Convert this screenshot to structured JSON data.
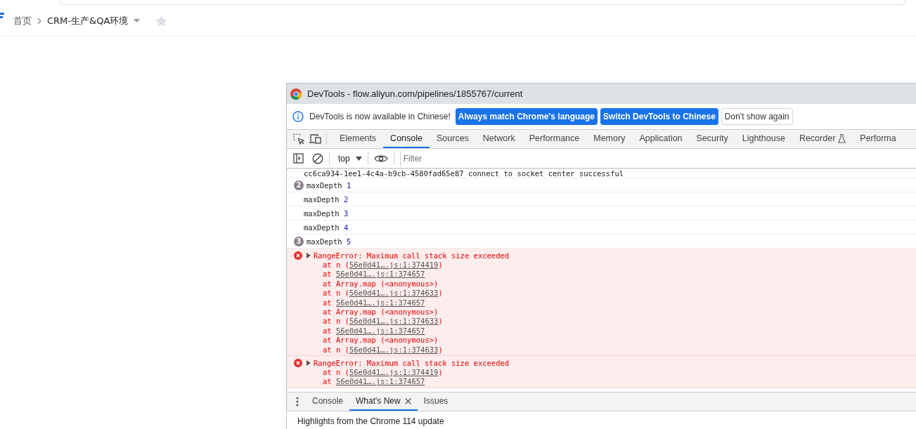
{
  "breadcrumb": {
    "home": "首页",
    "current": "CRM-生产&QA环境",
    "starred": false
  },
  "devtools": {
    "title": "DevTools - flow.aliyun.com/pipelines/1855767/current",
    "infobar": {
      "message": "DevTools is now available in Chinese!",
      "buttons": [
        {
          "label": "Always match Chrome's language",
          "kind": "primary"
        },
        {
          "label": "Switch DevTools to Chinese",
          "kind": "primary"
        },
        {
          "label": "Don't show again",
          "kind": "secondary"
        }
      ]
    },
    "tabs": [
      {
        "label": "Elements",
        "selected": false,
        "experimental": false
      },
      {
        "label": "Console",
        "selected": true,
        "experimental": false
      },
      {
        "label": "Sources",
        "selected": false,
        "experimental": false
      },
      {
        "label": "Network",
        "selected": false,
        "experimental": false
      },
      {
        "label": "Performance",
        "selected": false,
        "experimental": false
      },
      {
        "label": "Memory",
        "selected": false,
        "experimental": false
      },
      {
        "label": "Application",
        "selected": false,
        "experimental": false
      },
      {
        "label": "Security",
        "selected": false,
        "experimental": false
      },
      {
        "label": "Lighthouse",
        "selected": false,
        "experimental": false
      },
      {
        "label": "Recorder",
        "selected": false,
        "experimental": true
      },
      {
        "label": "Performa",
        "selected": false,
        "experimental": false
      }
    ],
    "context": "top",
    "filter": {
      "placeholder": "Filter"
    },
    "messages": [
      {
        "kind": "log",
        "text": "cc6ca934-1ee1-4c4a-b9cb-4580fad65e87 connect to socket center successful"
      },
      {
        "kind": "log",
        "count": "2",
        "label": "maxDepth",
        "value": "1"
      },
      {
        "kind": "log",
        "label": "maxDepth",
        "value": "2"
      },
      {
        "kind": "log",
        "label": "maxDepth",
        "value": "3"
      },
      {
        "kind": "log",
        "label": "maxDepth",
        "value": "4"
      },
      {
        "kind": "log",
        "count": "3",
        "label": "maxDepth",
        "value": "5"
      },
      {
        "kind": "error",
        "expanded": false,
        "text": "RangeError: Maximum call stack size exceeded",
        "stack": [
          {
            "prefix": "at n (",
            "link": "56e0d41….js:1:374419",
            "suffix": ")"
          },
          {
            "prefix": "at ",
            "link": "56e0d41….js:1:374657"
          },
          {
            "prefix": "at Array.map (<anonymous>)"
          },
          {
            "prefix": "at n (",
            "link": "56e0d41….js:1:374633",
            "suffix": ")"
          },
          {
            "prefix": "at ",
            "link": "56e0d41….js:1:374657"
          },
          {
            "prefix": "at Array.map (<anonymous>)"
          },
          {
            "prefix": "at n (",
            "link": "56e0d41….js:1:374633",
            "suffix": ")"
          },
          {
            "prefix": "at ",
            "link": "56e0d41….js:1:374657"
          },
          {
            "prefix": "at Array.map (<anonymous>)"
          },
          {
            "prefix": "at n (",
            "link": "56e0d41….js:1:374633",
            "suffix": ")"
          }
        ]
      },
      {
        "kind": "error",
        "expanded": false,
        "text": "RangeError: Maximum call stack size exceeded",
        "stack": [
          {
            "prefix": "at n (",
            "link": "56e0d41….js:1:374419",
            "suffix": ")"
          },
          {
            "prefix": "at ",
            "link": "56e0d41….js:1:374657"
          }
        ]
      }
    ],
    "drawer": {
      "tabs": [
        {
          "label": "Console",
          "selected": false,
          "closable": false
        },
        {
          "label": "What's New",
          "selected": true,
          "closable": true
        },
        {
          "label": "Issues",
          "selected": false,
          "closable": false
        }
      ],
      "content": "Highlights from the Chrome 114 update"
    }
  }
}
